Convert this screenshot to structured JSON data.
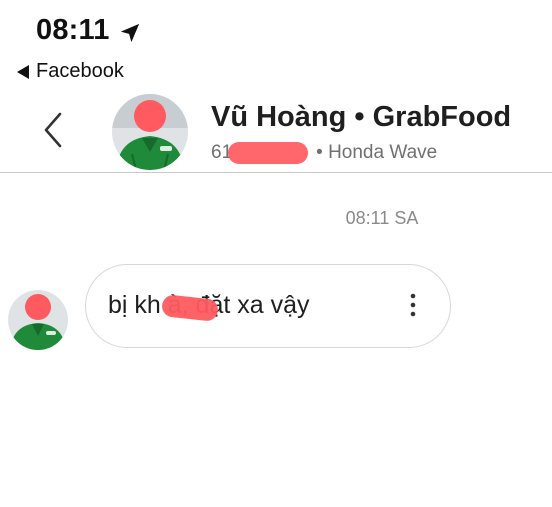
{
  "status_bar": {
    "time": "08:11",
    "location_icon": "location-arrow-icon",
    "back_app_label": "Facebook"
  },
  "header": {
    "back_icon": "chevron-left-icon",
    "contact_name": "Vũ Hoàng • GrabFood",
    "plate_prefix": "61",
    "vehicle": "• Honda Wave"
  },
  "conversation": {
    "timestamp": "08:11 SA",
    "messages": [
      {
        "text": "bị kh          à, đặt xa vậy",
        "menu_icon": "vertical-dots-icon"
      }
    ]
  },
  "colors": {
    "redaction": "#ff5a5f",
    "jacket_green": "#1f8a3a",
    "divider": "#c9c9c9"
  }
}
